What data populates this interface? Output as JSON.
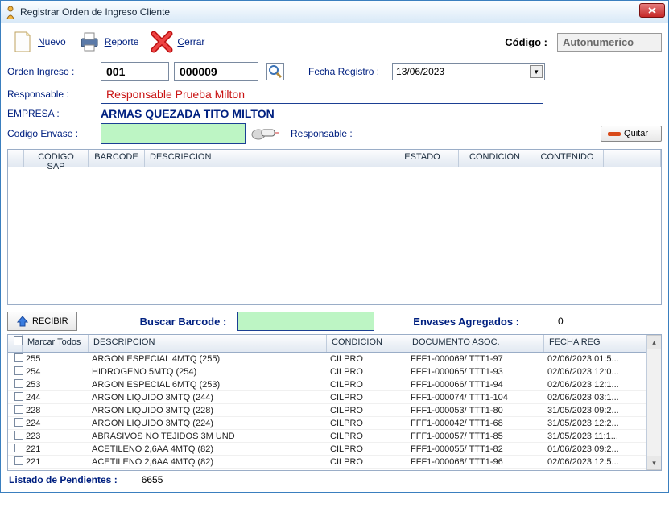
{
  "window": {
    "title": "Registrar Orden de Ingreso Cliente"
  },
  "toolbar": {
    "nuevo": "Nuevo",
    "reporte": "Reporte",
    "cerrar": "Cerrar",
    "codigo_label": "Código :",
    "codigo_value": "Autonumerico"
  },
  "form": {
    "orden_label": "Orden Ingreso :",
    "orden_prefix": "001",
    "orden_num": "000009",
    "fecha_label": "Fecha Registro :",
    "fecha_value": "13/06/2023",
    "responsable_label": "Responsable :",
    "responsable_value": "Responsable Prueba Milton",
    "empresa_label": "EMPRESA :",
    "empresa_value": "ARMAS QUEZADA TITO MILTON",
    "envase_label": "Codigo Envase :",
    "responsable2_label": "Responsable :",
    "quitar": "Quitar"
  },
  "grid1": {
    "cols": [
      "CODIGO SAP",
      "BARCODE",
      "DESCRIPCION",
      "ESTADO",
      "CONDICION",
      "CONTENIDO"
    ]
  },
  "recv": {
    "recibir": "RECIBIR",
    "buscar_label": "Buscar Barcode :",
    "agregados_label": "Envases Agregados :",
    "agregados_val": "0"
  },
  "grid2": {
    "marcar": "Marcar Todos",
    "cols": [
      "DESCRIPCION",
      "CONDICION",
      "DOCUMENTO ASOC.",
      "FECHA REG"
    ],
    "rows": [
      {
        "id": "255",
        "desc": "ARGON ESPECIAL 4MTQ (255)",
        "cond": "CILPRO",
        "doc": "FFF1-000069/ TTT1-97",
        "fecha": "02/06/2023 01:5..."
      },
      {
        "id": "254",
        "desc": "HIDROGENO 5MTQ (254)",
        "cond": "CILPRO",
        "doc": "FFF1-000065/ TTT1-93",
        "fecha": "02/06/2023 12:0..."
      },
      {
        "id": "253",
        "desc": "ARGON ESPECIAL 6MTQ (253)",
        "cond": "CILPRO",
        "doc": "FFF1-000066/ TTT1-94",
        "fecha": "02/06/2023 12:1..."
      },
      {
        "id": "244",
        "desc": "ARGON LIQUIDO 3MTQ (244)",
        "cond": "CILPRO",
        "doc": "FFF1-000074/ TTT1-104",
        "fecha": "02/06/2023 03:1..."
      },
      {
        "id": "228",
        "desc": "ARGON LIQUIDO 3MTQ (228)",
        "cond": "CILPRO",
        "doc": "FFF1-000053/ TTT1-80",
        "fecha": "31/05/2023 09:2..."
      },
      {
        "id": "224",
        "desc": "ARGON LIQUIDO 3MTQ (224)",
        "cond": "CILPRO",
        "doc": "FFF1-000042/ TTT1-68",
        "fecha": "31/05/2023 12:2..."
      },
      {
        "id": "223",
        "desc": "ABRASIVOS NO TEJIDOS 3M UND",
        "cond": "CILPRO",
        "doc": "FFF1-000057/ TTT1-85",
        "fecha": "31/05/2023 11:1..."
      },
      {
        "id": "221",
        "desc": "ACETILENO 2,6AA 4MTQ (82)",
        "cond": "CILPRO",
        "doc": "FFF1-000055/ TTT1-82",
        "fecha": "01/06/2023 09:2..."
      },
      {
        "id": "221",
        "desc": "ACETILENO 2,6AA 4MTQ (82)",
        "cond": "CILPRO",
        "doc": "FFF1-000068/ TTT1-96",
        "fecha": "02/06/2023 12:5..."
      }
    ]
  },
  "footer": {
    "label": "Listado de Pendientes :",
    "count": "6655"
  }
}
